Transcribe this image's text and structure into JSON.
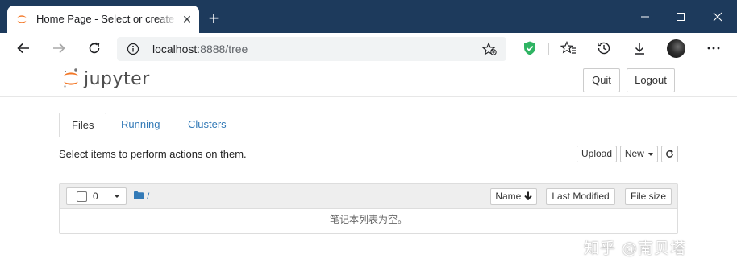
{
  "browser": {
    "tab_title": "Home Page - Select or create a n",
    "url_host": "localhost",
    "url_path": ":8888/tree",
    "window_controls": {
      "minimize_icon": "minimize-icon",
      "maximize_icon": "maximize-icon",
      "close_icon": "close-icon"
    },
    "toolbar_icons": [
      "back-icon",
      "forward-icon",
      "refresh-icon",
      "site-info-icon",
      "add-favorite-icon",
      "shield-icon",
      "favorites-icon",
      "history-icon",
      "download-icon",
      "profile-avatar",
      "more-icon"
    ],
    "colors": {
      "titlebar": "#1d3a5c",
      "shield": "#2fb463"
    }
  },
  "jupyter": {
    "logo_text": "jupyter",
    "quit_label": "Quit",
    "logout_label": "Logout",
    "tabs": [
      {
        "label": "Files",
        "active": true
      },
      {
        "label": "Running",
        "active": false
      },
      {
        "label": "Clusters",
        "active": false
      }
    ],
    "hint": "Select items to perform actions on them.",
    "upload_label": "Upload",
    "new_label": "New",
    "selected_count": "0",
    "breadcrumb": "/",
    "columns": {
      "name": "Name",
      "last_modified": "Last Modified",
      "file_size": "File size"
    },
    "empty_message": "笔记本列表为空。",
    "colors": {
      "logo_orange": "#f37726",
      "link": "#337ab7"
    }
  },
  "watermark": "知乎 @南贝塔"
}
